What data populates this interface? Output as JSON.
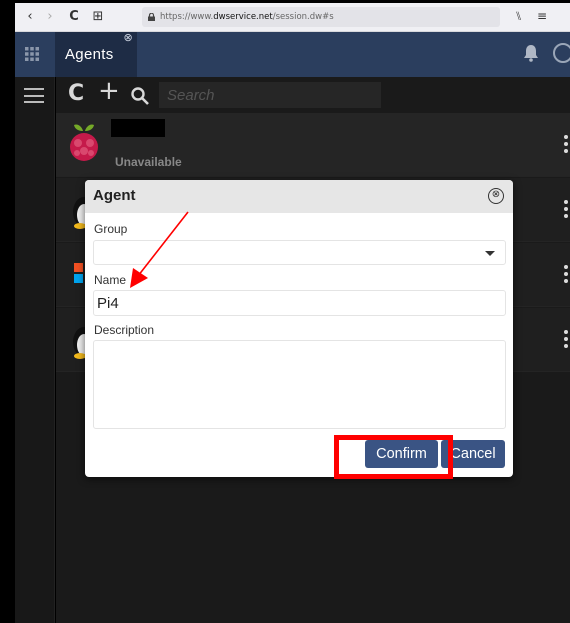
{
  "browser": {
    "url_prefix": "https://www.",
    "url_domain": "dwservice.net",
    "url_path": "/session.dw#s",
    "nav": {
      "back": "‹",
      "forward": "›",
      "reload": "C",
      "newtab": "⊞"
    },
    "right": {
      "library": "⑊",
      "menu": "≡"
    }
  },
  "header": {
    "tab_label": "Agents",
    "tab_close": "⊗"
  },
  "toolbar": {
    "refresh": "C",
    "add": "+",
    "search_placeholder": "Search"
  },
  "agents": [
    {
      "status": "Unavailable",
      "icon": "raspberry-pi-icon"
    },
    {
      "status": "",
      "icon": "linux-tux-icon"
    },
    {
      "status": "",
      "icon": "windows-icon"
    },
    {
      "status": "",
      "icon": "linux-tux-icon"
    }
  ],
  "dialog": {
    "title": "Agent",
    "close": "⊗",
    "group_label": "Group",
    "group_value": "",
    "name_label": "Name",
    "name_value": "Pi4",
    "description_label": "Description",
    "description_value": "",
    "confirm_label": "Confirm",
    "cancel_label": "Cancel"
  },
  "colors": {
    "header_bg": "#2b3e5e",
    "button_bg": "#3a5484",
    "annotation": "#ff0000"
  }
}
